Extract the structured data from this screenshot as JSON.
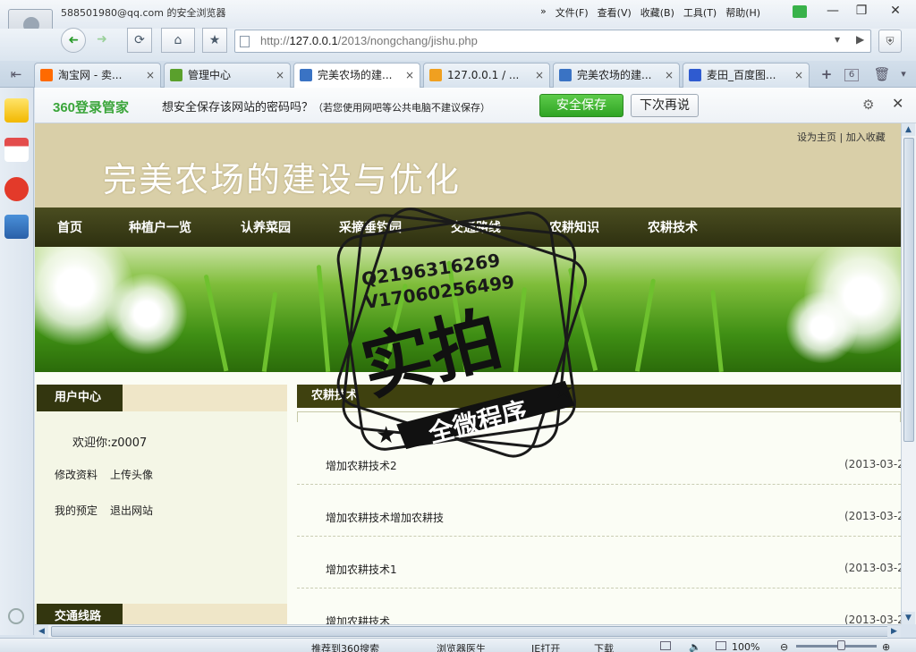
{
  "window": {
    "account": "588501980@qq.com 的安全浏览器",
    "menus": [
      "文件(F)",
      "查看(V)",
      "收藏(B)",
      "工具(T)",
      "帮助(H)"
    ],
    "menu_arrow": "»",
    "minimize": "—",
    "restore": "❐",
    "close": "✕"
  },
  "nav": {
    "back": "➜",
    "forward": "➜",
    "refresh": "⟳",
    "home": "⌂",
    "favorite": "★",
    "url_prefix": "http://",
    "url_host": "127.0.0.1",
    "url_path": "/2013/nongchang/jishu.php",
    "shield": "⛨"
  },
  "tabs": [
    {
      "label": "淘宝网 - 卖...",
      "icon_color": "#ff6a00"
    },
    {
      "label": "管理中心",
      "icon_color": "#5aa02c"
    },
    {
      "label": "完美农场的建...",
      "icon_color": "#3a73c4"
    },
    {
      "label": "127.0.0.1 / ...",
      "icon_color": "#f0a020"
    },
    {
      "label": "完美农场的建...",
      "icon_color": "#3a73c4"
    },
    {
      "label": "麦田_百度图...",
      "icon_color": "#2f5bd0"
    }
  ],
  "tab_close": "×",
  "tab_tools": {
    "new": "+",
    "count": "6",
    "trash": "🗑",
    "menu": "▾"
  },
  "password_bar": {
    "logo": "360登录管家",
    "question": "想安全保存该网站的密码吗？",
    "note": "（若您使用网吧等公共电脑不建议保存）",
    "save": "安全保存",
    "later": "下次再说",
    "gear": "⚙",
    "close": "✕"
  },
  "site": {
    "top_links": "设为主页  |  加入收藏",
    "title": "完美农场的建设与优化",
    "nav": [
      "首页",
      "种植户一览",
      "认养菜园",
      "采摘垂钓园",
      "交通路线",
      "农耕知识",
      "农耕技术"
    ]
  },
  "user_center": {
    "heading": "用户中心",
    "welcome": "欢迎你:z0007",
    "edit_profile": "修改资料",
    "upload_avatar": "上传头像",
    "my_booking": "我的预定",
    "logout": "退出网站",
    "traffic_heading": "交通线路"
  },
  "articles": {
    "heading": "农耕技术",
    "items": [
      {
        "title": "增加农耕技术2",
        "date": "(2013-03-2"
      },
      {
        "title": "增加农耕技术增加农耕技",
        "date": "(2013-03-2"
      },
      {
        "title": "增加农耕技术1",
        "date": "(2013-03-2"
      },
      {
        "title": "增加农耕技术",
        "date": "(2013-03-2"
      }
    ]
  },
  "status": {
    "recommend": "推荐到360搜索",
    "doctor": "浏览器医生",
    "ie": "IE打开",
    "download": "下载",
    "zoom": "100%",
    "zoom_level": 0.55
  },
  "watermark": {
    "qq": "Q2196316269",
    "vx": "V17060256499",
    "main": "实拍",
    "ribbon": "全微程序"
  }
}
